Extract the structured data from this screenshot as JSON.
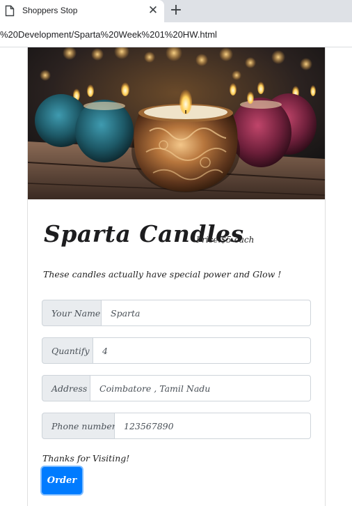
{
  "browser": {
    "tab_title": "Shoppers Stop",
    "tab_icon": "document-icon",
    "close_symbol": "✕",
    "new_tab_symbol": "+",
    "url": "%20Development/Sparta%20Week%201%20HW.html"
  },
  "hero": {
    "image": "candles-photo"
  },
  "product": {
    "title": "Sparta Candles",
    "price": "Price:$5 each",
    "tagline": "These candles actually have special power and Glow !"
  },
  "form": {
    "name_label": "Your Name",
    "name_value": "Sparta",
    "quantity_label": "Quantify",
    "quantity_value": "4",
    "address_label": "Address",
    "address_value": "Coimbatore , Tamil Nadu",
    "phone_label": "Phone number",
    "phone_value": "123567890"
  },
  "footer": {
    "thanks": "Thanks for Visiting!",
    "order_label": "Order"
  },
  "colors": {
    "primary": "#007bff",
    "addon_bg": "#e9ecef",
    "border": "#ced4da"
  }
}
